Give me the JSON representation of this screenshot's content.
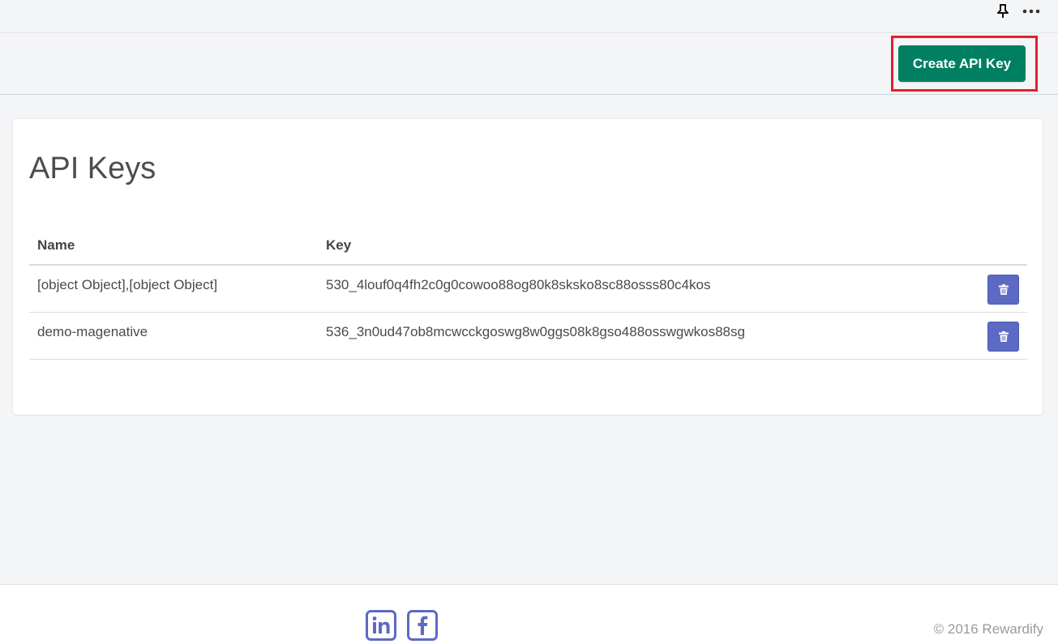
{
  "header": {
    "pin_icon": "pin-icon",
    "more_icon": "more-icon"
  },
  "actions": {
    "create_label": "Create API Key",
    "create_color": "#008060",
    "highlight_color": "#e3202b"
  },
  "main": {
    "title": "API Keys",
    "columns": [
      "Name",
      "Key"
    ],
    "rows": [
      {
        "name": "[object Object],[object Object]",
        "key": "530_4louf0q4fh2c0g0cowoo88og80k8sksko8sc88osss80c4kos",
        "action_icon": "trash-icon"
      },
      {
        "name": "demo-magenative",
        "key": "536_3n0ud47ob8mcwcckgoswg8w0ggs08k8gso488osswgwkos88sg",
        "action_icon": "trash-icon"
      }
    ],
    "delete_color": "#5c6ac4"
  },
  "footer": {
    "social_icons": [
      "linkedin-icon",
      "facebook-icon"
    ],
    "social_color": "#5c6ac4",
    "copyright": "© 2016 Rewardify"
  }
}
